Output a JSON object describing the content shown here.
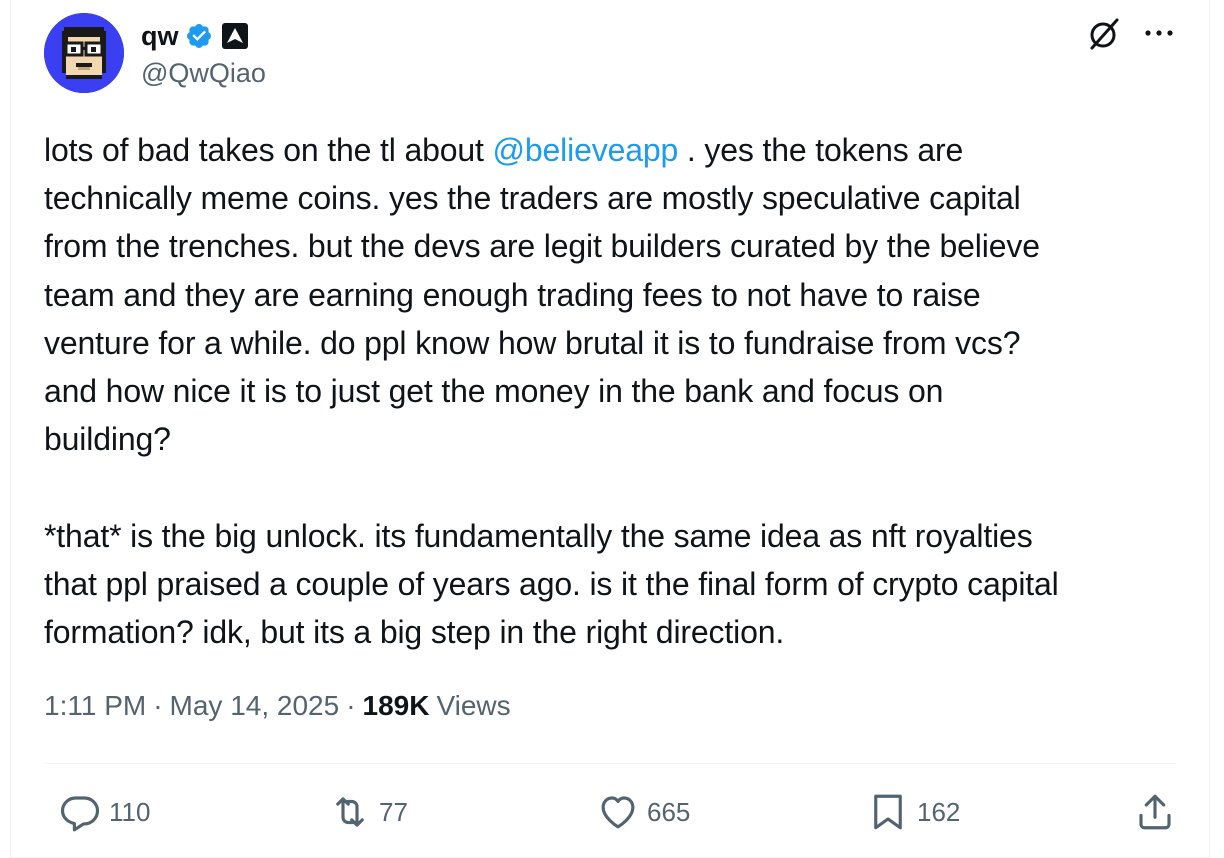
{
  "author": {
    "display_name": "qw",
    "handle": "@QwQiao",
    "avatar_icon": "pixel-face-avatar",
    "verified_icon": "verified-badge-icon",
    "affiliation_icon": "triangle-logo-icon"
  },
  "header_actions": {
    "grok_icon": "grok-icon",
    "more_icon": "more-icon"
  },
  "tweet": {
    "text_before_mention": "lots of bad takes on the tl about ",
    "mention": "@believeapp",
    "text_after_mention": " . yes the tokens are\ntechnically meme coins. yes the traders are mostly speculative capital\nfrom the trenches. but the devs are legit builders curated by the believe\nteam and they are earning enough trading fees to not have to raise\nventure for a while. do ppl know how brutal it is to fundraise from vcs?\nand how nice it is to just get the money in the bank and focus on\nbuilding?\n\n*that* is the big unlock. its fundamentally the same idea as nft royalties\nthat ppl praised a couple of years ago. is it the final form of crypto capital\nformation? idk, but its a big step in the right direction."
  },
  "meta": {
    "time": "1:11 PM",
    "separator": "·",
    "date": "May 14, 2025",
    "views_count": "189K",
    "views_label": "Views"
  },
  "actions": {
    "replies": "110",
    "reposts": "77",
    "likes": "665",
    "bookmarks": "162"
  },
  "colors": {
    "accent": "#1d9bf0",
    "secondary_text": "#536471",
    "primary_text": "#0f1419",
    "avatar_bg": "#3a3ff2"
  }
}
